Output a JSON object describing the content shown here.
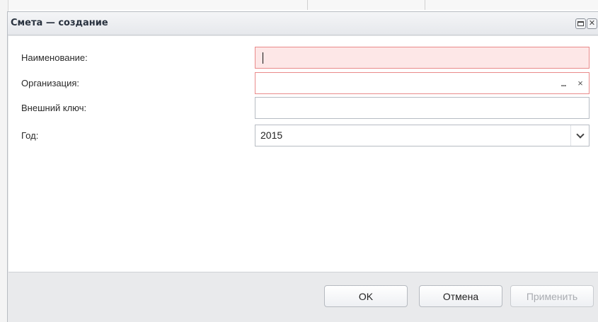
{
  "window": {
    "title": "Смета — создание",
    "icons": {
      "maximize": "maximize-icon",
      "close": "close-icon"
    }
  },
  "form": {
    "name": {
      "label": "Наименование:",
      "value": ""
    },
    "organization": {
      "label": "Организация:",
      "value": "",
      "lookup_glyph": "...",
      "clear_glyph": "×"
    },
    "external_key": {
      "label": "Внешний ключ:",
      "value": ""
    },
    "year": {
      "label": "Год:",
      "value": "2015"
    }
  },
  "buttons": {
    "ok": "OK",
    "cancel": "Отмена",
    "apply": "Применить"
  },
  "colors": {
    "invalid_border": "#e98a8a",
    "invalid_fill": "#fde7e7",
    "disabled_text": "#a9acb1"
  }
}
